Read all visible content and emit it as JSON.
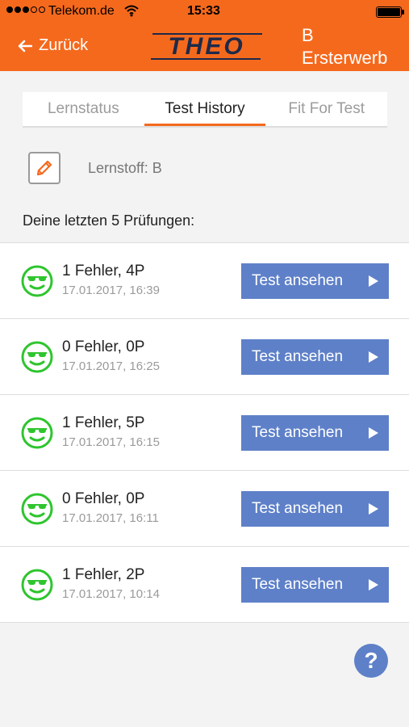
{
  "status_bar": {
    "carrier": "Telekom.de",
    "time": "15:33"
  },
  "header": {
    "back_label": "Zurück",
    "logo_text": "THEO",
    "topic_line1": "B",
    "topic_line2": "Ersterwerb",
    "background_color": "#f5691d"
  },
  "tabs": [
    {
      "label": "Lernstatus",
      "active": false
    },
    {
      "label": "Test History",
      "active": true
    },
    {
      "label": "Fit For Test",
      "active": false
    }
  ],
  "lernstoff": {
    "label": "Lernstoff: B",
    "icon": "pencil-icon"
  },
  "section_title": "Deine letzten 5 Prüfungen:",
  "tests": [
    {
      "title": "1 Fehler, 4P",
      "date": "17.01.2017, 16:39",
      "button": "Test ansehen"
    },
    {
      "title": "0 Fehler, 0P",
      "date": "17.01.2017, 16:25",
      "button": "Test ansehen"
    },
    {
      "title": "1 Fehler, 5P",
      "date": "17.01.2017, 16:15",
      "button": "Test ansehen"
    },
    {
      "title": "0 Fehler, 0P",
      "date": "17.01.2017, 16:11",
      "button": "Test ansehen"
    },
    {
      "title": "1 Fehler, 2P",
      "date": "17.01.2017, 10:14",
      "button": "Test ansehen"
    }
  ],
  "help_label": "?",
  "colors": {
    "accent": "#f5691d",
    "button": "#5e80c8",
    "smiley": "#2ec52e"
  }
}
